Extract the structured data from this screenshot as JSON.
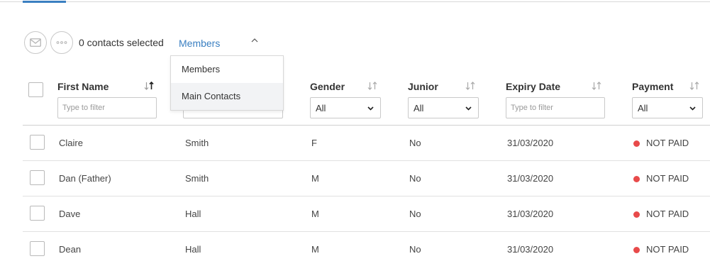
{
  "toolbar": {
    "email_icon": "envelope-icon",
    "more_icon": "ellipsis-icon",
    "selected_text": "0 contacts selected"
  },
  "view_select": {
    "value": "Members",
    "options": [
      "Members",
      "Main Contacts"
    ],
    "hovered_option": "Main Contacts"
  },
  "columns": {
    "first_name": {
      "label": "First Name",
      "filter_placeholder": "Type to filter"
    },
    "gender": {
      "label": "Gender",
      "filter_value": "All"
    },
    "junior": {
      "label": "Junior",
      "filter_value": "All"
    },
    "expiry_date": {
      "label": "Expiry Date",
      "filter_placeholder": "Type to filter"
    },
    "payment": {
      "label": "Payment",
      "filter_value": "All"
    }
  },
  "rows": [
    {
      "first_name": "Claire",
      "last_name": "Smith",
      "gender": "F",
      "junior": "No",
      "expiry": "31/03/2020",
      "payment": "NOT PAID"
    },
    {
      "first_name": "Dan (Father)",
      "last_name": "Smith",
      "gender": "M",
      "junior": "No",
      "expiry": "31/03/2020",
      "payment": "NOT PAID"
    },
    {
      "first_name": "Dave",
      "last_name": "Hall",
      "gender": "M",
      "junior": "No",
      "expiry": "31/03/2020",
      "payment": "NOT PAID"
    },
    {
      "first_name": "Dean",
      "last_name": "Hall",
      "gender": "M",
      "junior": "No",
      "expiry": "31/03/2020",
      "payment": "NOT PAID"
    }
  ],
  "colors": {
    "accent": "#3a7fc1",
    "not_paid": "#e84a4a"
  }
}
